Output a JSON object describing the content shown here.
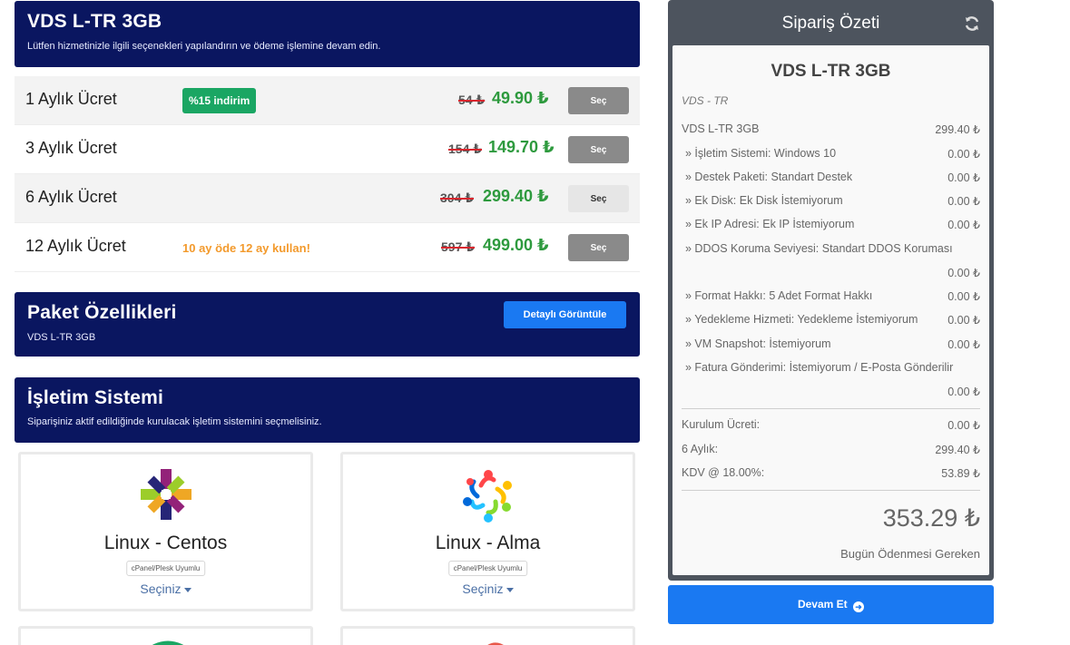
{
  "product_header": {
    "title": "VDS L-TR 3GB",
    "subtitle": "Lütfen hizmetinizle ilgili seçenekleri yapılandırın ve ödeme işlemine devam edin."
  },
  "billing_cycles": [
    {
      "label": "1 Aylık Ücret",
      "badge": "%15 indirim",
      "old_price": "54 ₺",
      "price": "49.90 ₺",
      "button": "Seç",
      "active": false
    },
    {
      "label": "3 Aylık Ücret",
      "badge": "",
      "old_price": "154 ₺",
      "price": "149.70 ₺",
      "button": "Seç",
      "active": false
    },
    {
      "label": "6 Aylık Ücret",
      "badge": "",
      "old_price": "304 ₺",
      "price": "299.40 ₺",
      "button": "Seç",
      "active": true
    },
    {
      "label": "12 Aylık Ücret",
      "promo": "10 ay öde 12 ay kullan!",
      "old_price": "597 ₺",
      "price": "499.00 ₺",
      "button": "Seç",
      "active": false
    }
  ],
  "package_header": {
    "title": "Paket Özellikleri",
    "subtitle": "VDS L-TR 3GB",
    "detail_button": "Detaylı Görüntüle"
  },
  "os_header": {
    "title": "İşletim Sistemi",
    "subtitle": "Siparişiniz aktif edildiğinde kurulacak işletim sistemini seçmelisiniz."
  },
  "os_options": [
    {
      "name": "Linux - Centos",
      "compat": "cPanel/Plesk Uyumlu",
      "select": "Seçiniz",
      "icon": "centos-logo-icon"
    },
    {
      "name": "Linux - Alma",
      "compat": "cPanel/Plesk Uyumlu",
      "select": "Seçiniz",
      "icon": "almalinux-logo-icon"
    }
  ],
  "summary": {
    "title": "Sipariş Özeti",
    "product_name": "VDS L-TR 3GB",
    "product_group": "VDS - TR",
    "base": {
      "label": "VDS L-TR 3GB",
      "amount": "299.40 ₺"
    },
    "options": [
      {
        "label": "» İşletim Sistemi: Windows 10",
        "amount": "0.00 ₺"
      },
      {
        "label": "» Destek Paketi: Standart Destek",
        "amount": "0.00 ₺"
      },
      {
        "label": "» Ek Disk: Ek Disk İstemiyorum",
        "amount": "0.00 ₺"
      },
      {
        "label": "» Ek IP Adresi: Ek IP İstemiyorum",
        "amount": "0.00 ₺"
      },
      {
        "label": "» DDOS Koruma Seviyesi: Standart DDOS Koruması",
        "amount": "0.00 ₺"
      },
      {
        "label": "» Format Hakkı: 5 Adet Format Hakkı",
        "amount": "0.00 ₺"
      },
      {
        "label": "» Yedekleme Hizmeti: Yedekleme İstemiyorum",
        "amount": "0.00 ₺"
      },
      {
        "label": "» VM Snapshot: İstemiyorum",
        "amount": "0.00 ₺"
      },
      {
        "label": "» Fatura Gönderimi: İstemiyorum / E-Posta Gönderilir",
        "amount": "0.00 ₺"
      }
    ],
    "setup": {
      "label": "Kurulum Ücreti:",
      "amount": "0.00 ₺"
    },
    "cycle": {
      "label": "6 Aylık:",
      "amount": "299.40 ₺"
    },
    "tax": {
      "label": "KDV @ 18.00%:",
      "amount": "53.89 ₺"
    },
    "total": "353.29 ₺",
    "total_label": "Bugün Ödenmesi Gereken"
  },
  "continue_button": "Devam Et",
  "colors": {
    "navy": "#0a1660",
    "accent_blue": "#1a79f2",
    "price_green": "#2e9a3e",
    "badge_green": "#1aa663",
    "promo_orange": "#f39a2c",
    "summary_dark": "#4d545e"
  }
}
